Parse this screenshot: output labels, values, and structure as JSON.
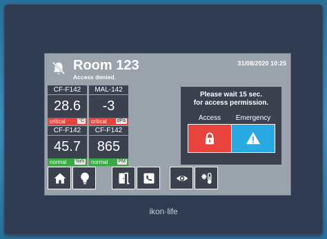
{
  "header": {
    "room": "Room 123",
    "status": "Access denied.",
    "datetime": "31/08/2020 10:25",
    "icon": "muted-bell-icon"
  },
  "tiles": [
    {
      "name": "CF-F142",
      "value": "28.6",
      "status": "critical",
      "unit": "°C"
    },
    {
      "name": "MAL-142",
      "value": "-3",
      "status": "critical",
      "unit": "dPa"
    },
    {
      "name": "CF-F142",
      "value": "45.7",
      "status": "normal",
      "unit": "%rh"
    },
    {
      "name": "CF-F142",
      "value": "865",
      "status": "normal",
      "unit": "PM"
    }
  ],
  "access_panel": {
    "message_line1": "Please wait 15 sec.",
    "message_line2": "for access permission.",
    "access_label": "Access",
    "emergency_label": "Emergency"
  },
  "nav": [
    "home-icon",
    "lightbulb-icon",
    "door-icon",
    "phone-icon",
    "eye-icon",
    "snow-thermometer-icon"
  ],
  "brand": {
    "left": "ikon",
    "right": "life"
  },
  "colors": {
    "critical": "#e8433d",
    "normal": "#3aa945",
    "emergency": "#29a9e1",
    "tile": "#3c4150"
  }
}
